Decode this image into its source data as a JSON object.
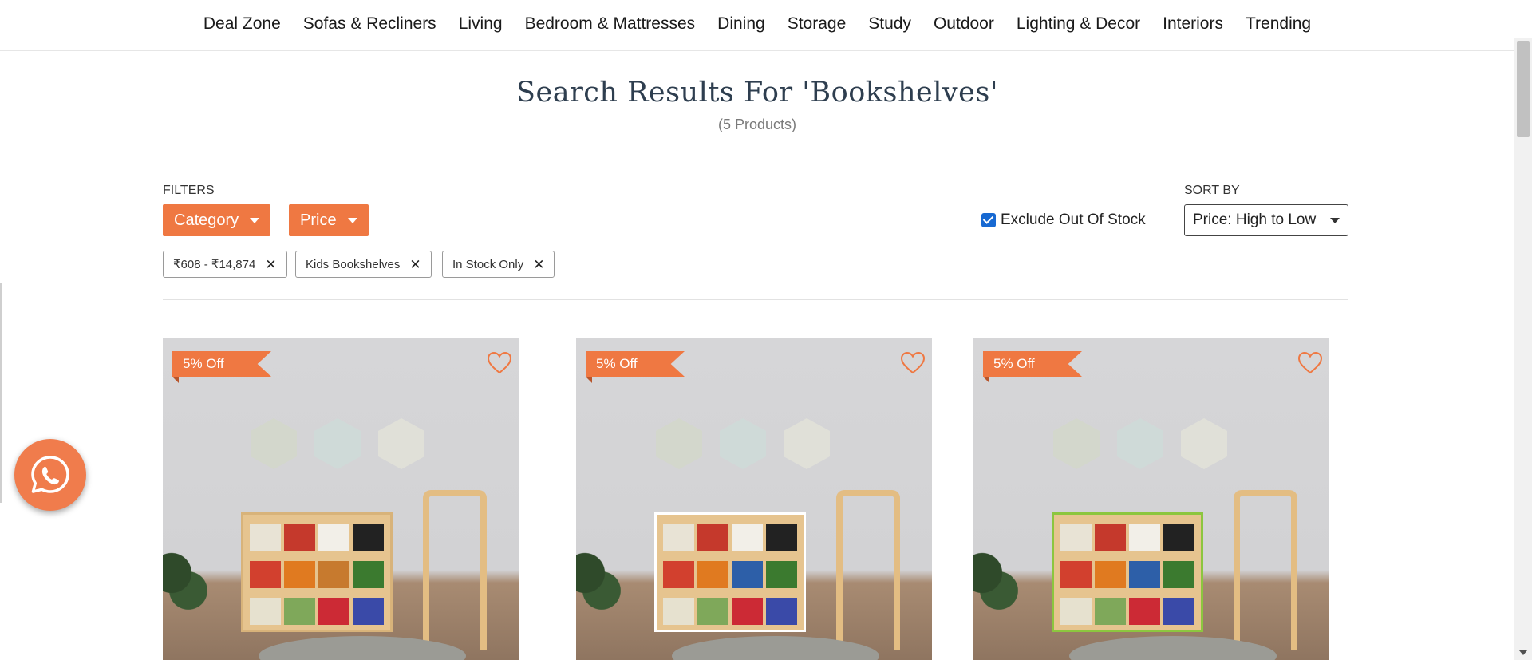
{
  "nav": {
    "items": [
      "Deal Zone",
      "Sofas & Recliners",
      "Living",
      "Bedroom & Mattresses",
      "Dining",
      "Storage",
      "Study",
      "Outdoor",
      "Lighting & Decor",
      "Interiors",
      "Trending"
    ]
  },
  "search": {
    "title": "Search Results For 'Bookshelves'",
    "count": "(5 Products)"
  },
  "filters": {
    "label": "FILTERS",
    "category_label": "Category",
    "price_label": "Price",
    "chips": [
      "₹608 - ₹14,874",
      "Kids Bookshelves",
      "In Stock Only"
    ],
    "exclude_out_of_stock": "Exclude Out Of Stock",
    "exclude_checked": true
  },
  "sort": {
    "label": "SORT BY",
    "selected": "Price: High to Low"
  },
  "products": [
    {
      "badge": "5% Off",
      "shelf_frame_color": "#e6c48f"
    },
    {
      "badge": "5% Off",
      "shelf_frame_color": "#ffffff"
    },
    {
      "badge": "5% Off",
      "shelf_frame_color": "#8cc63f"
    }
  ],
  "colors": {
    "accent": "#ef7842",
    "heading": "#2e3e4f",
    "checkbox": "#1769d2"
  },
  "icons": {
    "whatsapp": "whatsapp-icon",
    "heart": "heart-icon",
    "remove": "close-icon",
    "dropdown": "chevron-down-icon"
  }
}
